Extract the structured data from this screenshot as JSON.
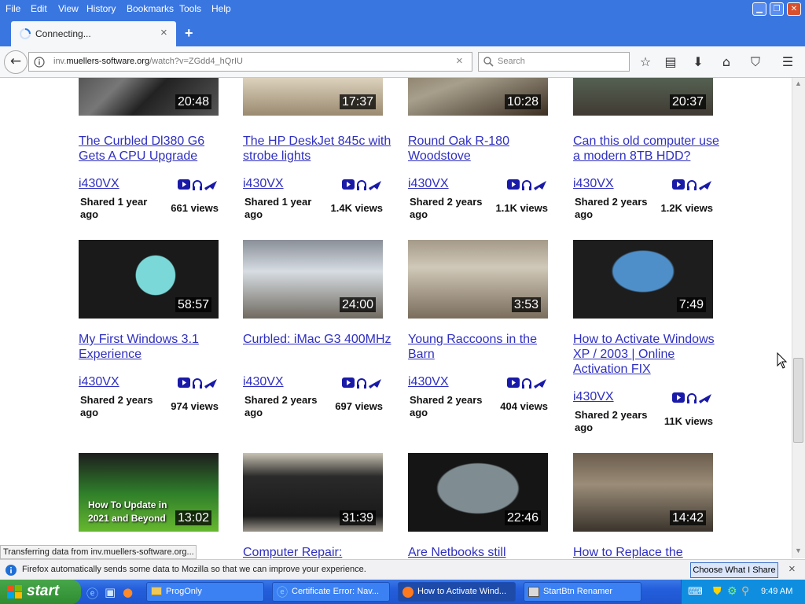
{
  "menu": [
    "File",
    "Edit",
    "View",
    "History",
    "Bookmarks",
    "Tools",
    "Help"
  ],
  "tab": {
    "title": "Connecting...",
    "close": "×",
    "new_tab": "+"
  },
  "url": {
    "prefix": "inv.",
    "domain": "muellers-software.org",
    "path": "/watch?v=ZGdd4_hQrIU",
    "clear": "×"
  },
  "search": {
    "placeholder": "Search"
  },
  "videos": [
    {
      "title": "The Curbled Dl380 G6 Gets A CPU Upgrade",
      "duration": "20:48",
      "author": "i430VX",
      "shared": "Shared 1 year ago",
      "views": "661 views"
    },
    {
      "title": "The HP DeskJet 845c with strobe lights",
      "duration": "17:37",
      "author": "i430VX",
      "shared": "Shared 1 year ago",
      "views": "1.4K views"
    },
    {
      "title": "Round Oak R-180 Woodstove",
      "duration": "10:28",
      "author": "i430VX",
      "shared": "Shared 2 years ago",
      "views": "1.1K views"
    },
    {
      "title": "Can this old computer use a modern 8TB HDD?",
      "duration": "20:37",
      "author": "i430VX",
      "shared": "Shared 2 years ago",
      "views": "1.2K views"
    },
    {
      "title": "My First Windows 3.1 Experience",
      "duration": "58:57",
      "author": "i430VX",
      "shared": "Shared 2 years ago",
      "views": "974 views"
    },
    {
      "title": "Curbled: iMac G3 400MHz",
      "duration": "24:00",
      "author": "i430VX",
      "shared": "Shared 2 years ago",
      "views": "697 views"
    },
    {
      "title": "Young Raccoons in the Barn",
      "duration": "3:53",
      "author": "i430VX",
      "shared": "Shared 2 years ago",
      "views": "404 views"
    },
    {
      "title": "How to Activate Windows XP / 2003 | Online Activation FIX",
      "duration": "7:49",
      "author": "i430VX",
      "shared": "Shared 2 years ago",
      "views": "11K views"
    },
    {
      "title": "",
      "duration": "13:02",
      "thumb_text": "How To Update in 2021 and Beyond"
    },
    {
      "title": "Computer Repair:",
      "duration": "31:39"
    },
    {
      "title": "Are Netbooks still",
      "duration": "22:46"
    },
    {
      "title": "How to Replace the",
      "duration": "14:42"
    }
  ],
  "status_text": "Transferring data from inv.muellers-software.org...",
  "notification": {
    "text": "Firefox automatically sends some data to Mozilla so that we can improve your experience.",
    "button": "Choose What I Share",
    "close": "×"
  },
  "taskbar": {
    "start": "start",
    "tasks": [
      {
        "label": "ProgOnly"
      },
      {
        "label": "Certificate Error: Nav..."
      },
      {
        "label": "How to Activate Wind..."
      },
      {
        "label": "StartBtn Renamer"
      }
    ],
    "clock": "9:49 AM"
  },
  "colors": {
    "link": "#2f2fc0",
    "titlebar": "#3a76e0",
    "taskbar": "#245edb",
    "start": "#2f8c31"
  },
  "icons": [
    "info-icon",
    "search-icon",
    "star-icon",
    "reader-icon",
    "download-icon",
    "home-icon",
    "pocket-icon",
    "hamburger-menu-icon",
    "youtube-icon",
    "headphones-icon",
    "plane-icon"
  ]
}
